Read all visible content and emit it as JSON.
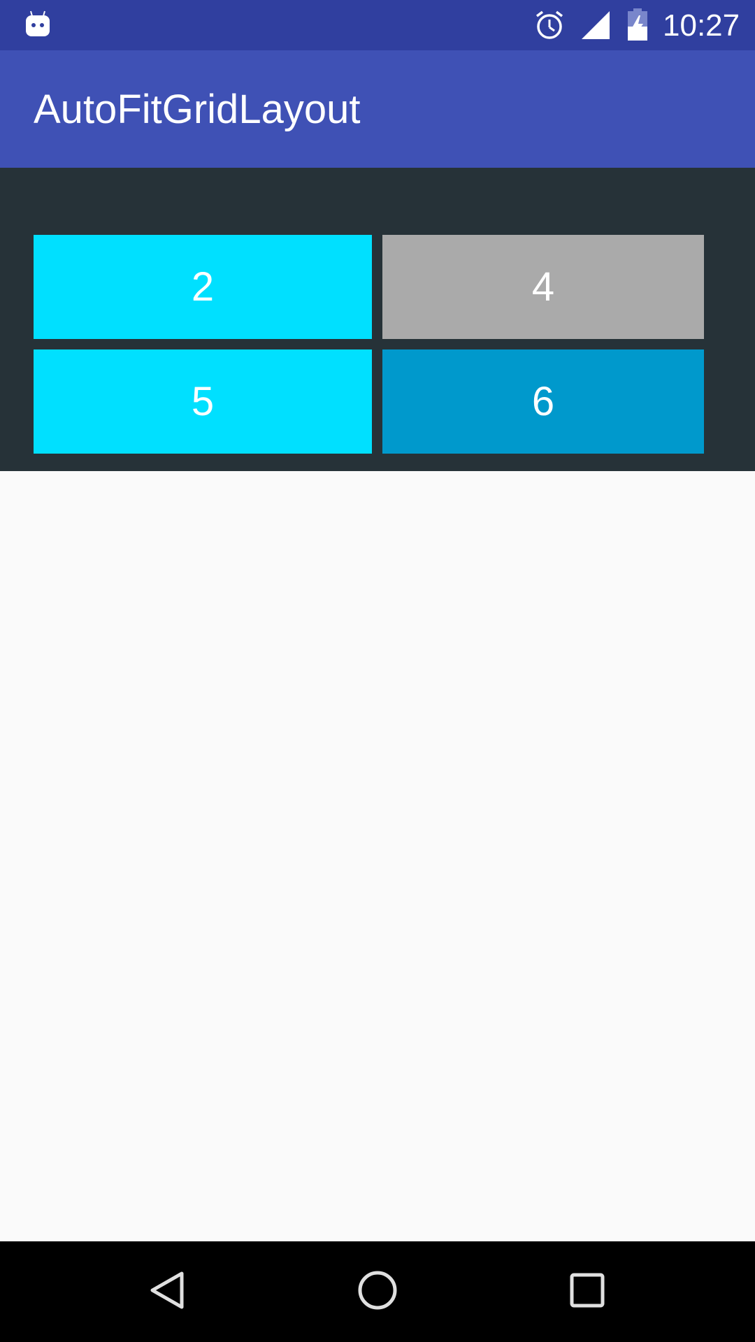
{
  "status_bar": {
    "time": "10:27",
    "icons": [
      "android-notification-icon",
      "alarm-icon",
      "signal-icon",
      "battery-charging-icon"
    ]
  },
  "app_bar": {
    "title": "AutoFitGridLayout"
  },
  "grid": {
    "tiles": [
      {
        "label": "2",
        "color": "#00e0ff"
      },
      {
        "label": "4",
        "color": "#aaaaaa"
      },
      {
        "label": "5",
        "color": "#00e0ff"
      },
      {
        "label": "6",
        "color": "#0099cc"
      }
    ]
  },
  "colors": {
    "status_bar": "#303f9f",
    "app_bar": "#3f51b5",
    "grid_background": "#263238",
    "content_background": "#fafafa",
    "nav_bar": "#000000"
  },
  "nav_bar": {
    "buttons": [
      "back-icon",
      "home-icon",
      "recents-icon"
    ]
  }
}
